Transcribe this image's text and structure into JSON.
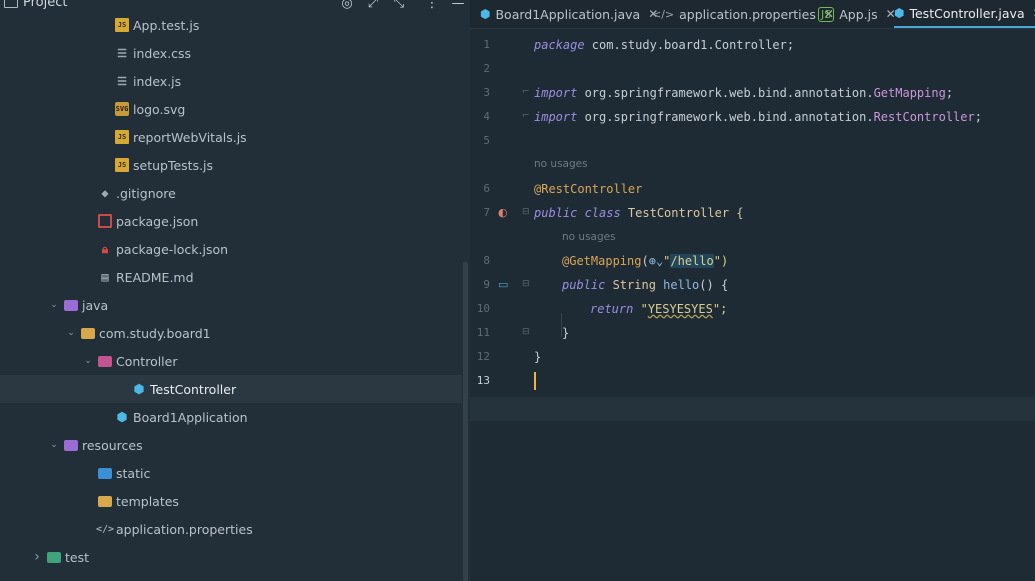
{
  "panel": {
    "title": "Project"
  },
  "tree": [
    {
      "label": "App.test.js",
      "icon": "js-file-icon",
      "level": 5,
      "arrow": ""
    },
    {
      "label": "index.css",
      "icon": "css-file-icon",
      "level": 5,
      "arrow": ""
    },
    {
      "label": "index.js",
      "icon": "js-lines-file-icon",
      "level": 5,
      "arrow": ""
    },
    {
      "label": "logo.svg",
      "icon": "svg-file-icon",
      "level": 5,
      "arrow": ""
    },
    {
      "label": "reportWebVitals.js",
      "icon": "js-file-icon",
      "level": 5,
      "arrow": ""
    },
    {
      "label": "setupTests.js",
      "icon": "js-file-icon",
      "level": 5,
      "arrow": ""
    },
    {
      "label": ".gitignore",
      "icon": "gitignore-icon",
      "level": 4,
      "arrow": ""
    },
    {
      "label": "package.json",
      "icon": "npm-package-icon",
      "level": 4,
      "arrow": ""
    },
    {
      "label": "package-lock.json",
      "icon": "lock-icon",
      "level": 4,
      "arrow": ""
    },
    {
      "label": "README.md",
      "icon": "readme-icon",
      "level": 4,
      "arrow": ""
    },
    {
      "label": "java",
      "icon": "source-folder-icon",
      "level": 2,
      "arrow": "down"
    },
    {
      "label": "com.study.board1",
      "icon": "package-folder-icon",
      "level": 3,
      "arrow": "down"
    },
    {
      "label": "Controller",
      "icon": "controller-folder-icon",
      "level": 4,
      "arrow": "down"
    },
    {
      "label": "TestController",
      "icon": "class-icon",
      "level": 6,
      "arrow": "",
      "selected": true
    },
    {
      "label": "Board1Application",
      "icon": "spring-app-icon",
      "level": 5,
      "arrow": ""
    },
    {
      "label": "resources",
      "icon": "resources-folder-icon",
      "level": 2,
      "arrow": "down"
    },
    {
      "label": "static",
      "icon": "static-folder-icon",
      "level": 4,
      "arrow": ""
    },
    {
      "label": "templates",
      "icon": "templates-folder-icon",
      "level": 4,
      "arrow": ""
    },
    {
      "label": "application.properties",
      "icon": "properties-file-icon",
      "level": 4,
      "arrow": ""
    },
    {
      "label": "test",
      "icon": "test-folder-icon",
      "level": 1,
      "arrow": "right"
    }
  ],
  "tabs": [
    {
      "label": "Board1Application.java",
      "icon": "java-class-icon",
      "active": false
    },
    {
      "label": "application.properties",
      "icon": "properties-tab-icon",
      "active": false
    },
    {
      "label": "App.js",
      "icon": "nodejs-icon",
      "active": false
    },
    {
      "label": "TestController.java",
      "icon": "java-class-icon",
      "active": true
    }
  ],
  "editor": {
    "line_numbers": [
      "1",
      "2",
      "3",
      "4",
      "5",
      "6",
      "7",
      "8",
      "9",
      "10",
      "11",
      "12",
      "13"
    ],
    "hints": {
      "usages_1": "no usages",
      "usages_2": "no usages"
    },
    "code": {
      "l1_kw": "package",
      "l1_rest": " com.study.board1.Controller;",
      "l3_kw": "import",
      "l3_pkg": " org.springframework.web.bind.annotation.",
      "l3_cls": "GetMapping",
      "l3_end": ";",
      "l4_kw": "import",
      "l4_pkg": " org.springframework.web.bind.annotation.",
      "l4_cls": "RestController",
      "l4_end": ";",
      "l6_ann": "@RestController",
      "l7_kw": "public class",
      "l7_name": " TestController {",
      "l8_ann": "@GetMapping",
      "l8_open": "(",
      "l8_str_q": "\"",
      "l8_str": "/hello",
      "l8_close": "\")",
      "l9_kw": "public",
      "l9_type": " String ",
      "l9_meth": "hello",
      "l9_rest": "() {",
      "l10_kw": "return",
      "l10_q1": " \"",
      "l10_str": "YESYESYES",
      "l10_q2": "\";",
      "l11": "}",
      "l12": "}"
    }
  }
}
